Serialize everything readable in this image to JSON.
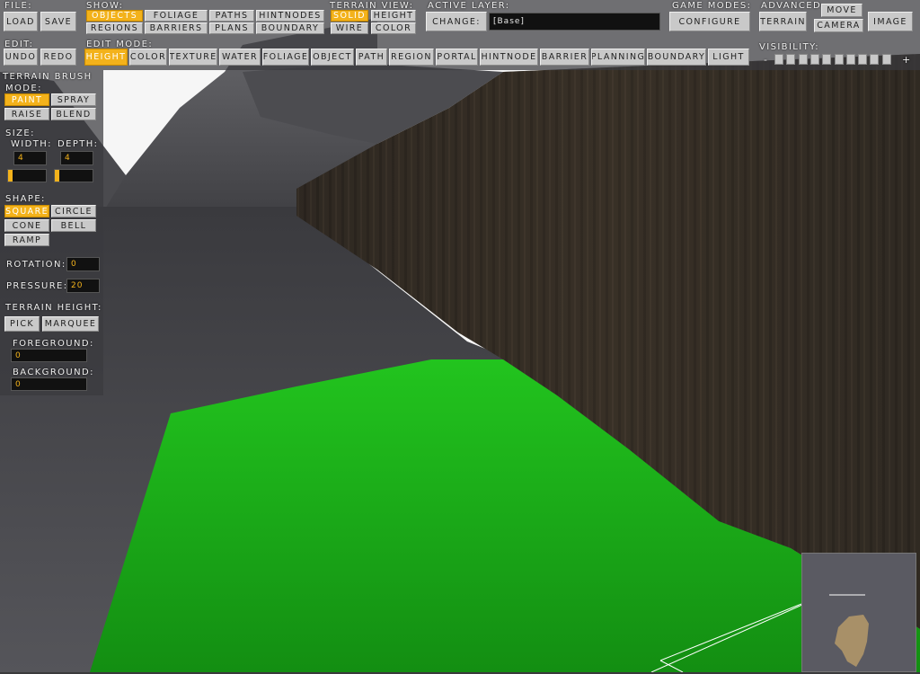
{
  "file": {
    "label": "File:",
    "load": "Load",
    "save": "Save"
  },
  "show": {
    "label": "Show:",
    "objects": "Objects",
    "foliage": "Foliage",
    "paths": "Paths",
    "hintnodes": "HintNodes",
    "regions": "Regions",
    "barriers": "Barriers",
    "plans": "Plans",
    "boundary": "Boundary"
  },
  "terrain_view": {
    "label": "Terrain View:",
    "solid": "Solid",
    "height": "Height",
    "wire": "Wire",
    "color": "Color"
  },
  "active_layer": {
    "label": "Active Layer:",
    "change": "Change:",
    "value": "[Base]"
  },
  "game_modes": {
    "label": "Game Modes:",
    "configure": "Configure"
  },
  "advanced": {
    "label": "Advanced",
    "terrain": "Terrain",
    "move": "Move",
    "camera": "Camera",
    "image": "Image"
  },
  "edit": {
    "label": "Edit:",
    "undo": "Undo",
    "redo": "Redo"
  },
  "edit_mode": {
    "label": "Edit Mode:",
    "modes": [
      "Height",
      "Color",
      "Texture",
      "Water",
      "Foliage",
      "Object",
      "Path",
      "Region",
      "Portal",
      "HintNode",
      "Barrier",
      "Planning",
      "Boundary",
      "Light"
    ],
    "active": "Height"
  },
  "visibility": {
    "label": "Visibility:",
    "minus": "-",
    "plus": "+",
    "boxes": 10
  },
  "terrain_brush": {
    "title": "Terrain Brush",
    "mode_label": "Mode:",
    "paint": "Paint",
    "spray": "Spray",
    "raise": "Raise",
    "blend": "Blend",
    "size_label": "Size:",
    "width_label": "Width:",
    "depth_label": "Depth:",
    "width_value": "4",
    "depth_value": "4",
    "shape_label": "Shape:",
    "square": "Square",
    "circle": "Circle",
    "cone": "Cone",
    "bell": "Bell",
    "ramp": "Ramp",
    "rotation_label": "Rotation:",
    "rotation_value": "0",
    "pressure_label": "Pressure:",
    "pressure_value": "20",
    "terrain_height_label": "Terrain Height:",
    "pick": "Pick",
    "marquee": "Marquee",
    "foreground_label": "Foreground:",
    "foreground_value": "0",
    "background_label": "Background:",
    "background_value": "0"
  },
  "colors": {
    "accent": "#f3b21b",
    "highlight_green": "#1cc11c"
  }
}
